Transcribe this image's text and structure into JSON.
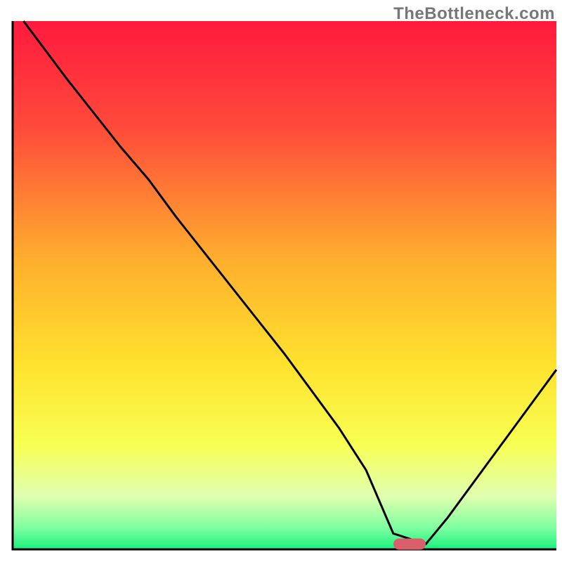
{
  "watermark": "TheBottleneck.com",
  "chart_data": {
    "type": "line",
    "title": "",
    "xlabel": "",
    "ylabel": "",
    "xlim": [
      0,
      100
    ],
    "ylim": [
      0,
      100
    ],
    "grid": false,
    "legend": false,
    "description": "Bottleneck-percentage curve over a red→yellow→green vertical gradient. The black curve starts near the top-left (very high bottleneck), falls with a slight knee around x≈25, reaches ~0 around x≈70–76, then rises again toward the right edge. A small rounded red marker sits at the curve minimum.",
    "x": [
      2,
      10,
      20,
      25,
      30,
      40,
      50,
      60,
      65,
      70,
      76,
      80,
      90,
      100
    ],
    "values": [
      100,
      89,
      76,
      70,
      63,
      50,
      37,
      23,
      15,
      3,
      1,
      6,
      20,
      34
    ],
    "marker": {
      "x": 73,
      "y": 1
    },
    "gradient_stops": [
      {
        "pct": 0,
        "color": "#ff1a3e"
      },
      {
        "pct": 20,
        "color": "#ff4a3a"
      },
      {
        "pct": 45,
        "color": "#ffae2e"
      },
      {
        "pct": 65,
        "color": "#ffe22e"
      },
      {
        "pct": 80,
        "color": "#f7ff52"
      },
      {
        "pct": 90,
        "color": "#e0ffb0"
      },
      {
        "pct": 96,
        "color": "#7dffa0"
      },
      {
        "pct": 100,
        "color": "#19ef7e"
      }
    ],
    "axis_color": "#000000",
    "curve_color": "#000000",
    "marker_color": "#d9606b"
  }
}
